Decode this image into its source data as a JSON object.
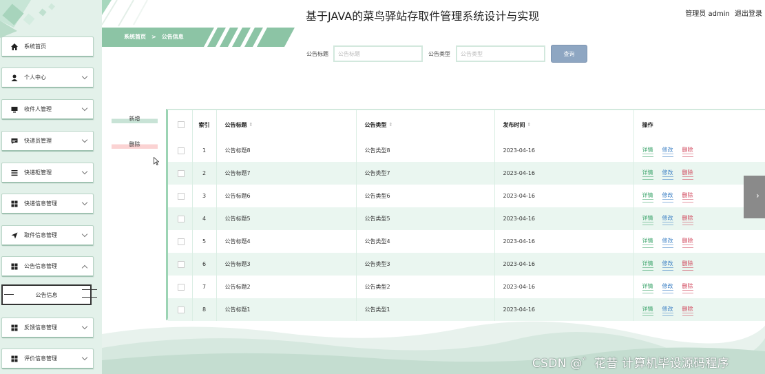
{
  "header": {
    "title": "基于JAVA的菜鸟驿站存取件管理系统设计与实现",
    "user_label": "管理员 admin",
    "logout_label": "退出登录"
  },
  "breadcrumb": {
    "home": "系统首页",
    "separator": ">",
    "current": "公告信息"
  },
  "sidebar": {
    "items": [
      {
        "label": "系统首页",
        "icon": "home-icon",
        "has_arrow": false
      },
      {
        "label": "个人中心",
        "icon": "user-icon",
        "has_arrow": true
      },
      {
        "label": "收件人管理",
        "icon": "monitor-icon",
        "has_arrow": true
      },
      {
        "label": "快递员管理",
        "icon": "chat-icon",
        "has_arrow": true
      },
      {
        "label": "快递柜管理",
        "icon": "list-icon",
        "has_arrow": true
      },
      {
        "label": "快递信息管理",
        "icon": "grid-icon",
        "has_arrow": true
      },
      {
        "label": "取件信息管理",
        "icon": "send-icon",
        "has_arrow": true
      },
      {
        "label": "公告信息管理",
        "icon": "grid-icon",
        "has_arrow": true,
        "expanded": true
      },
      {
        "label": "反馈信息管理",
        "icon": "grid-icon",
        "has_arrow": true
      },
      {
        "label": "评价信息管理",
        "icon": "grid-icon",
        "has_arrow": true
      }
    ],
    "sub_item": "公告信息"
  },
  "search": {
    "title_label": "公告标题",
    "title_placeholder": "公告标题",
    "type_label": "公告类型",
    "type_placeholder": "公告类型",
    "button": "查询"
  },
  "actions": {
    "add": "新增",
    "delete": "删除"
  },
  "table": {
    "headers": {
      "index": "索引",
      "title": "公告标题",
      "type": "公告类型",
      "time": "发布时间",
      "ops": "操作"
    },
    "op_labels": {
      "detail": "详情",
      "edit": "修改",
      "delete": "删除"
    },
    "rows": [
      {
        "index": "1",
        "title": "公告标题8",
        "type": "公告类型8",
        "time": "2023-04-16"
      },
      {
        "index": "2",
        "title": "公告标题7",
        "type": "公告类型7",
        "time": "2023-04-16"
      },
      {
        "index": "3",
        "title": "公告标题6",
        "type": "公告类型6",
        "time": "2023-04-16"
      },
      {
        "index": "4",
        "title": "公告标题5",
        "type": "公告类型5",
        "time": "2023-04-16"
      },
      {
        "index": "5",
        "title": "公告标题4",
        "type": "公告类型4",
        "time": "2023-04-16"
      },
      {
        "index": "6",
        "title": "公告标题3",
        "type": "公告类型3",
        "time": "2023-04-16"
      },
      {
        "index": "7",
        "title": "公告标题2",
        "type": "公告类型2",
        "time": "2023-04-16"
      },
      {
        "index": "8",
        "title": "公告标题1",
        "type": "公告类型1",
        "time": "2023-04-16"
      }
    ]
  },
  "watermark": "CSDN @゛花昔  计算机毕设源码程序",
  "colors": {
    "sidebar_bg": "#e3f1ea",
    "accent_green": "#9cd4b4",
    "search_button": "#8ea6c2",
    "op_detail": "#3aa36a",
    "op_edit": "#3b7fc4",
    "op_delete": "#d0455a"
  }
}
